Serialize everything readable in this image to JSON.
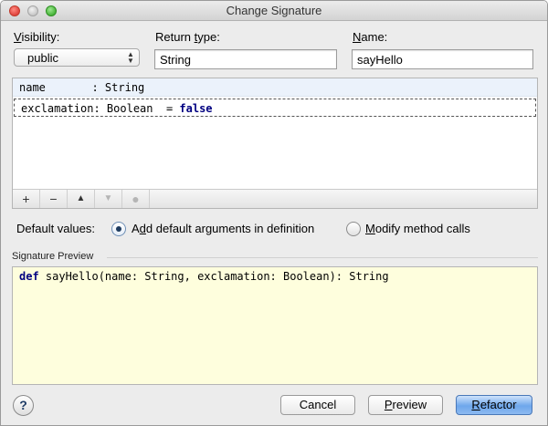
{
  "window": {
    "title": "Change Signature"
  },
  "fields": {
    "visibility": {
      "label_first": "V",
      "label_rest": "isibility:",
      "value": "public"
    },
    "return_type": {
      "label_pre": "Return ",
      "label_mnemonic": "t",
      "label_post": "ype:",
      "value": "String"
    },
    "name": {
      "label_first": "N",
      "label_rest": "ame:",
      "value": "sayHello"
    }
  },
  "parameters": {
    "rows": [
      {
        "text": "name       : String",
        "default_sep": "",
        "default_value": ""
      },
      {
        "text": "exclamation: Boolean",
        "default_sep": "  = ",
        "default_value": "false"
      }
    ],
    "toolbar": {
      "add": "+",
      "remove": "−",
      "move_up": "▲",
      "move_down": "▼",
      "edit": "●"
    }
  },
  "default_values": {
    "label": "Default values:",
    "option_add_first": "A",
    "option_add_mnemonic": "d",
    "option_add_rest": "d default arguments in definition",
    "option_modify_mnemonic": "M",
    "option_modify_rest": "odify method calls",
    "selected": "add"
  },
  "signature_preview": {
    "section_title": "Signature Preview",
    "keyword": "def",
    "text": " sayHello(name: String, exclamation: Boolean): String"
  },
  "buttons": {
    "help": "?",
    "cancel": "Cancel",
    "preview_mnemonic": "P",
    "preview_rest": "review",
    "refactor_mnemonic": "R",
    "refactor_rest": "efactor"
  },
  "colors": {
    "preview_bg": "#fefedd",
    "keyword": "#000080",
    "primary_button": "#6ea7ec"
  }
}
